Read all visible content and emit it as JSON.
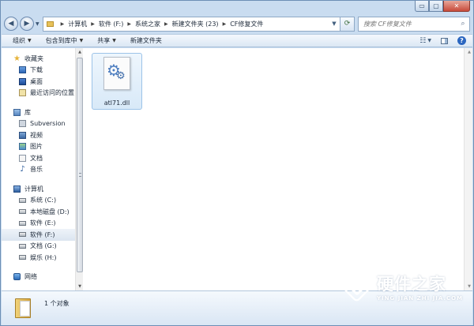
{
  "window": {
    "caption": {
      "minimize_glyph": "▭",
      "maximize_glyph": "▢",
      "close_glyph": "✕"
    }
  },
  "address_bar": {
    "back_glyph": "◀",
    "forward_glyph": "▶",
    "history_glyph": "▼",
    "breadcrumbs": [
      "计算机",
      "软件 (F:)",
      "系统之家",
      "新建文件夹 (23)",
      "CF修复文件"
    ],
    "separator_glyph": "▶",
    "dropdown_glyph": "▼",
    "refresh_glyph": "⟳",
    "search_placeholder": "搜索 CF修复文件",
    "search_glyph": "⌕"
  },
  "toolbar": {
    "organize_label": "组织",
    "include_label": "包含到库中",
    "share_label": "共享",
    "new_folder_label": "新建文件夹",
    "dropdown_glyph": "▼",
    "view_glyph": "☷",
    "help_glyph": "?"
  },
  "nav_pane": {
    "favorites": {
      "label": "收藏夹",
      "items": [
        "下载",
        "桌面",
        "最近访问的位置"
      ]
    },
    "libraries": {
      "label": "库",
      "items": [
        "Subversion",
        "视频",
        "图片",
        "文档",
        "音乐"
      ]
    },
    "computer": {
      "label": "计算机",
      "items": [
        "系统 (C:)",
        "本地磁盘 (D:)",
        "软件 (E:)",
        "软件 (F:)",
        "文档 (G:)",
        "娱乐 (H:)"
      ],
      "selected_index": 3
    },
    "network": {
      "label": "网络"
    },
    "star_glyph": "★",
    "music_glyph": "♪"
  },
  "files": [
    {
      "name": "atl71.dll",
      "icon": "dll-file-icon",
      "gear_glyph": "⚙"
    }
  ],
  "scrollbar": {
    "up_glyph": "▲",
    "down_glyph": "▼"
  },
  "details_pane": {
    "text": "1 个对象"
  },
  "watermark": {
    "cn": "硬件之家",
    "en": "YING JIAN ZHI JIA.COM"
  }
}
